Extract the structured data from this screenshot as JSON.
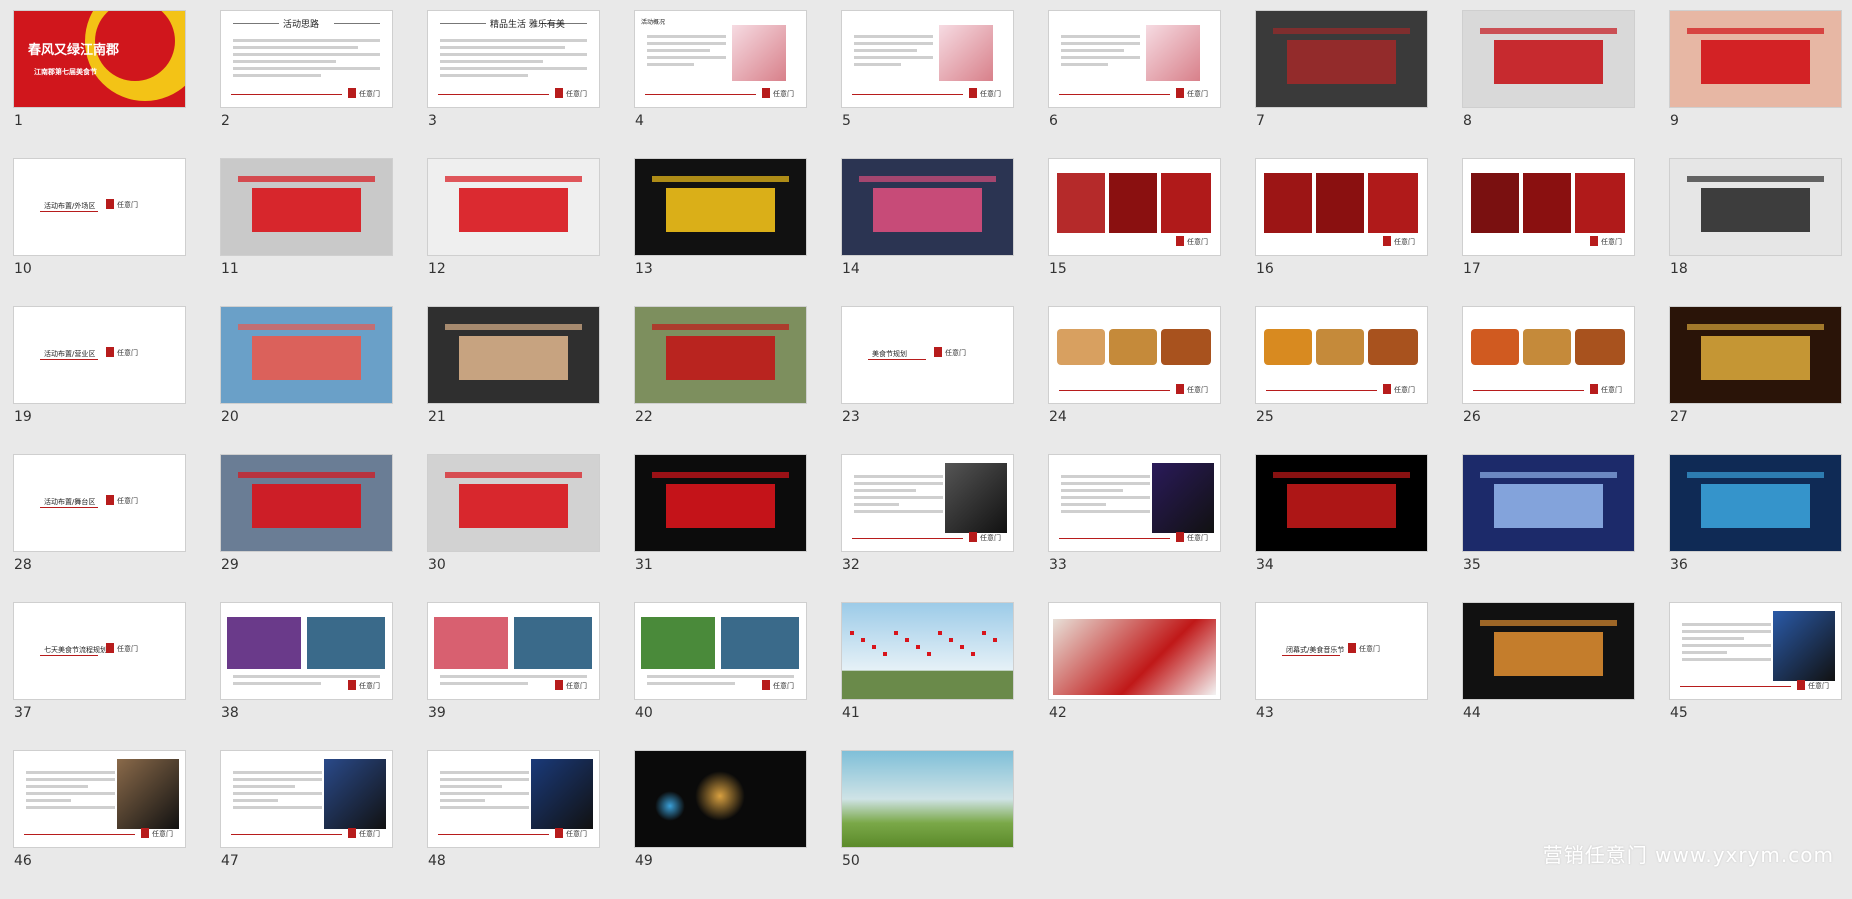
{
  "slides": [
    {
      "n": "1",
      "style": "cover",
      "title": "春风又绿江南郡",
      "subtitle": "江南郡第七届美食节"
    },
    {
      "n": "2",
      "style": "text",
      "heading": "活动思路"
    },
    {
      "n": "3",
      "style": "text2",
      "heading": "精品生活 雅乐有美"
    },
    {
      "n": "4",
      "style": "textimg",
      "heading": "活动概况"
    },
    {
      "n": "5",
      "style": "textimg2",
      "heading": ""
    },
    {
      "n": "6",
      "style": "textimg3",
      "heading": ""
    },
    {
      "n": "7",
      "style": "render",
      "tone": "#9d2a2a",
      "bg": "#3a3a3a",
      "caption": ""
    },
    {
      "n": "8",
      "style": "render",
      "tone": "#c4161c",
      "bg": "#d9d9d9",
      "caption": ""
    },
    {
      "n": "9",
      "style": "render",
      "tone": "#d01217",
      "bg": "#e7b7a4",
      "caption": ""
    },
    {
      "n": "10",
      "style": "section",
      "heading": "活动布置/外场区"
    },
    {
      "n": "11",
      "style": "render",
      "tone": "#d8141b",
      "bg": "#c9c9c9",
      "caption": ""
    },
    {
      "n": "12",
      "style": "render",
      "tone": "#d8141b",
      "bg": "#efefef",
      "caption": ""
    },
    {
      "n": "13",
      "style": "render",
      "tone": "#f1c11a",
      "bg": "#111111",
      "caption": ""
    },
    {
      "n": "14",
      "style": "photo",
      "tone": "#d84e7c",
      "bg": "#2b3452",
      "caption": ""
    },
    {
      "n": "15",
      "style": "photos3",
      "tone": "#b52a2a",
      "bg": "#ffffff",
      "caption": ""
    },
    {
      "n": "16",
      "style": "photos3",
      "tone": "#9c1515",
      "bg": "#ffffff",
      "caption": ""
    },
    {
      "n": "17",
      "style": "photos3",
      "tone": "#7a1010",
      "bg": "#ffffff",
      "caption": ""
    },
    {
      "n": "18",
      "style": "render",
      "tone": "#2a2a2a",
      "bg": "#e6e6e6",
      "caption": ""
    },
    {
      "n": "19",
      "style": "section",
      "heading": "活动布置/营业区"
    },
    {
      "n": "20",
      "style": "render",
      "tone": "#e85a4f",
      "bg": "#6aa0c8",
      "caption": ""
    },
    {
      "n": "21",
      "style": "photo",
      "tone": "#d8b08a",
      "bg": "#2f2f2f",
      "caption": ""
    },
    {
      "n": "22",
      "style": "photo",
      "tone": "#c01818",
      "bg": "#7d8f5e",
      "caption": ""
    },
    {
      "n": "23",
      "style": "section",
      "heading": "美食节规划"
    },
    {
      "n": "24",
      "style": "food",
      "tone": "#d8a060",
      "bg": "#ffffff",
      "caption": ""
    },
    {
      "n": "25",
      "style": "food",
      "tone": "#d88a20",
      "bg": "#ffffff",
      "caption": ""
    },
    {
      "n": "26",
      "style": "food",
      "tone": "#d05a20",
      "bg": "#ffffff",
      "caption": ""
    },
    {
      "n": "27",
      "style": "render",
      "tone": "#d6a43a",
      "bg": "#2a1408",
      "caption": ""
    },
    {
      "n": "28",
      "style": "section",
      "heading": "活动布置/舞台区"
    },
    {
      "n": "29",
      "style": "render",
      "tone": "#d8141b",
      "bg": "#6a7d95",
      "caption": ""
    },
    {
      "n": "30",
      "style": "render",
      "tone": "#d8141b",
      "bg": "#d2d2d2",
      "caption": ""
    },
    {
      "n": "31",
      "style": "render",
      "tone": "#d8141b",
      "bg": "#0c0c0c",
      "caption": ""
    },
    {
      "n": "32",
      "style": "textphoto",
      "tone": "#555555",
      "bg": "#ffffff",
      "caption": ""
    },
    {
      "n": "33",
      "style": "textphoto2",
      "tone": "#2a1a5a",
      "bg": "#ffffff",
      "caption": ""
    },
    {
      "n": "34",
      "style": "photo",
      "tone": "#c01818",
      "bg": "#000000",
      "caption": ""
    },
    {
      "n": "35",
      "style": "photo",
      "tone": "#8fb0e8",
      "bg": "#1c2a6a",
      "caption": ""
    },
    {
      "n": "36",
      "style": "photo",
      "tone": "#3aa0d8",
      "bg": "#0f2a55",
      "caption": ""
    },
    {
      "n": "37",
      "style": "section",
      "heading": "七天美食节流程规划"
    },
    {
      "n": "38",
      "style": "photos2",
      "tone": "#6a3a8a",
      "bg": "#ffffff",
      "caption": ""
    },
    {
      "n": "39",
      "style": "photos2",
      "tone": "#d86070",
      "bg": "#ffffff",
      "caption": ""
    },
    {
      "n": "40",
      "style": "photos2",
      "tone": "#4a8a3a",
      "bg": "#ffffff",
      "caption": ""
    },
    {
      "n": "41",
      "style": "sky",
      "tone": "#d8141b",
      "bg": "#9ccbe8",
      "caption": ""
    },
    {
      "n": "42",
      "style": "photo2",
      "tone": "#c01818",
      "bg": "#ffffff",
      "caption": ""
    },
    {
      "n": "43",
      "style": "section",
      "heading": "闭幕式/美食音乐节"
    },
    {
      "n": "44",
      "style": "photo",
      "tone": "#d88a30",
      "bg": "#111111",
      "caption": ""
    },
    {
      "n": "45",
      "style": "textphoto3",
      "tone": "#2a5aa8",
      "bg": "#ffffff",
      "caption": ""
    },
    {
      "n": "46",
      "style": "textphoto4",
      "tone": "#8a6a4a",
      "bg": "#ffffff",
      "caption": ""
    },
    {
      "n": "47",
      "style": "textphoto4",
      "tone": "#2a4a8a",
      "bg": "#ffffff",
      "caption": ""
    },
    {
      "n": "48",
      "style": "textphoto4",
      "tone": "#1a3a7a",
      "bg": "#ffffff",
      "caption": ""
    },
    {
      "n": "49",
      "style": "fireworks",
      "tone": "#d8a040",
      "bg": "#0a0a0a",
      "caption": ""
    },
    {
      "n": "50",
      "style": "landscape",
      "tone": "#7aa848",
      "bg": "#7fbfd8",
      "caption": ""
    }
  ],
  "watermark": "营销任意门 www.yxrym.com",
  "brand_label": "任意门"
}
